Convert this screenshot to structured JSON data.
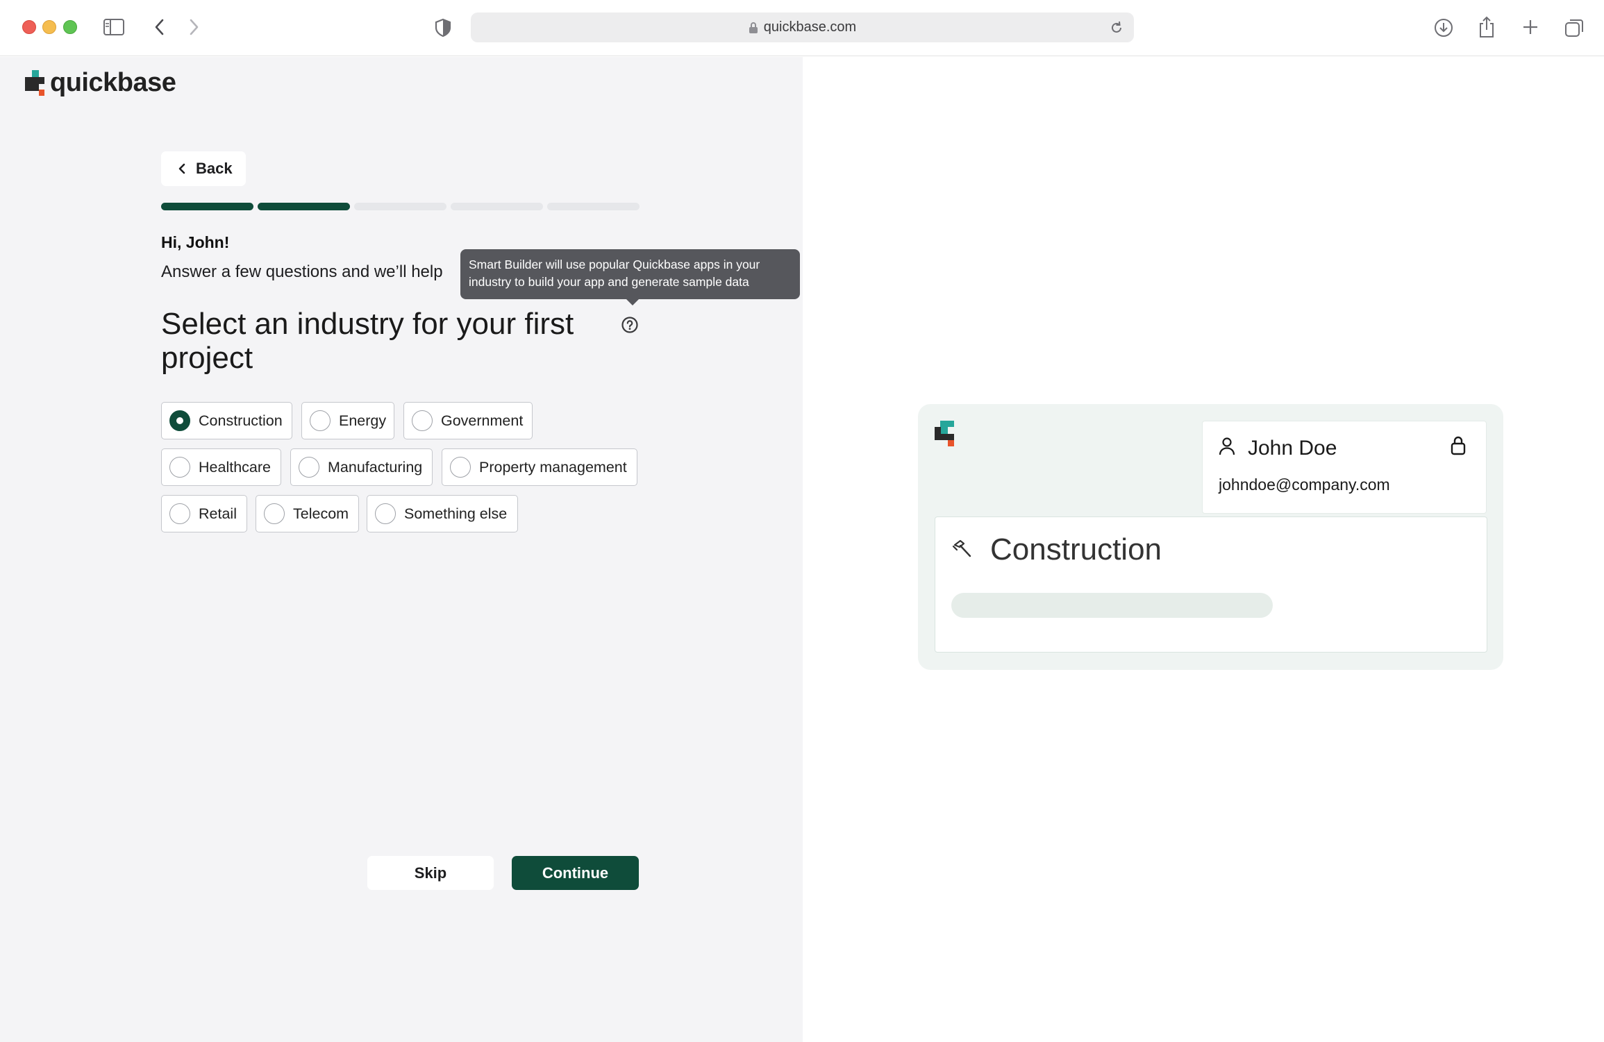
{
  "browser": {
    "url": "quickbase.com"
  },
  "brand": {
    "name": "quickbase",
    "accent_color": "#0f4c3a",
    "logo_colors": [
      "#2a2a2a",
      "#26a69a",
      "#e8542b"
    ]
  },
  "nav": {
    "back_label": "Back"
  },
  "progress": {
    "steps_total": 5,
    "steps_completed": 2
  },
  "intro": {
    "greeting": "Hi, John!",
    "subtitle": "Answer a few questions and we’ll help",
    "heading": "Select an industry for your first project"
  },
  "tooltip": {
    "text": "Smart Builder will use popular Quickbase apps in your industry to build your app and generate sample data"
  },
  "industries": {
    "selected": "Construction",
    "options": [
      "Construction",
      "Energy",
      "Government",
      "Healthcare",
      "Manufacturing",
      "Property management",
      "Retail",
      "Telecom",
      "Something else"
    ]
  },
  "actions": {
    "skip_label": "Skip",
    "continue_label": "Continue"
  },
  "preview": {
    "user_name": "John Doe",
    "user_email": "johndoe@company.com",
    "project_title": "Construction"
  }
}
